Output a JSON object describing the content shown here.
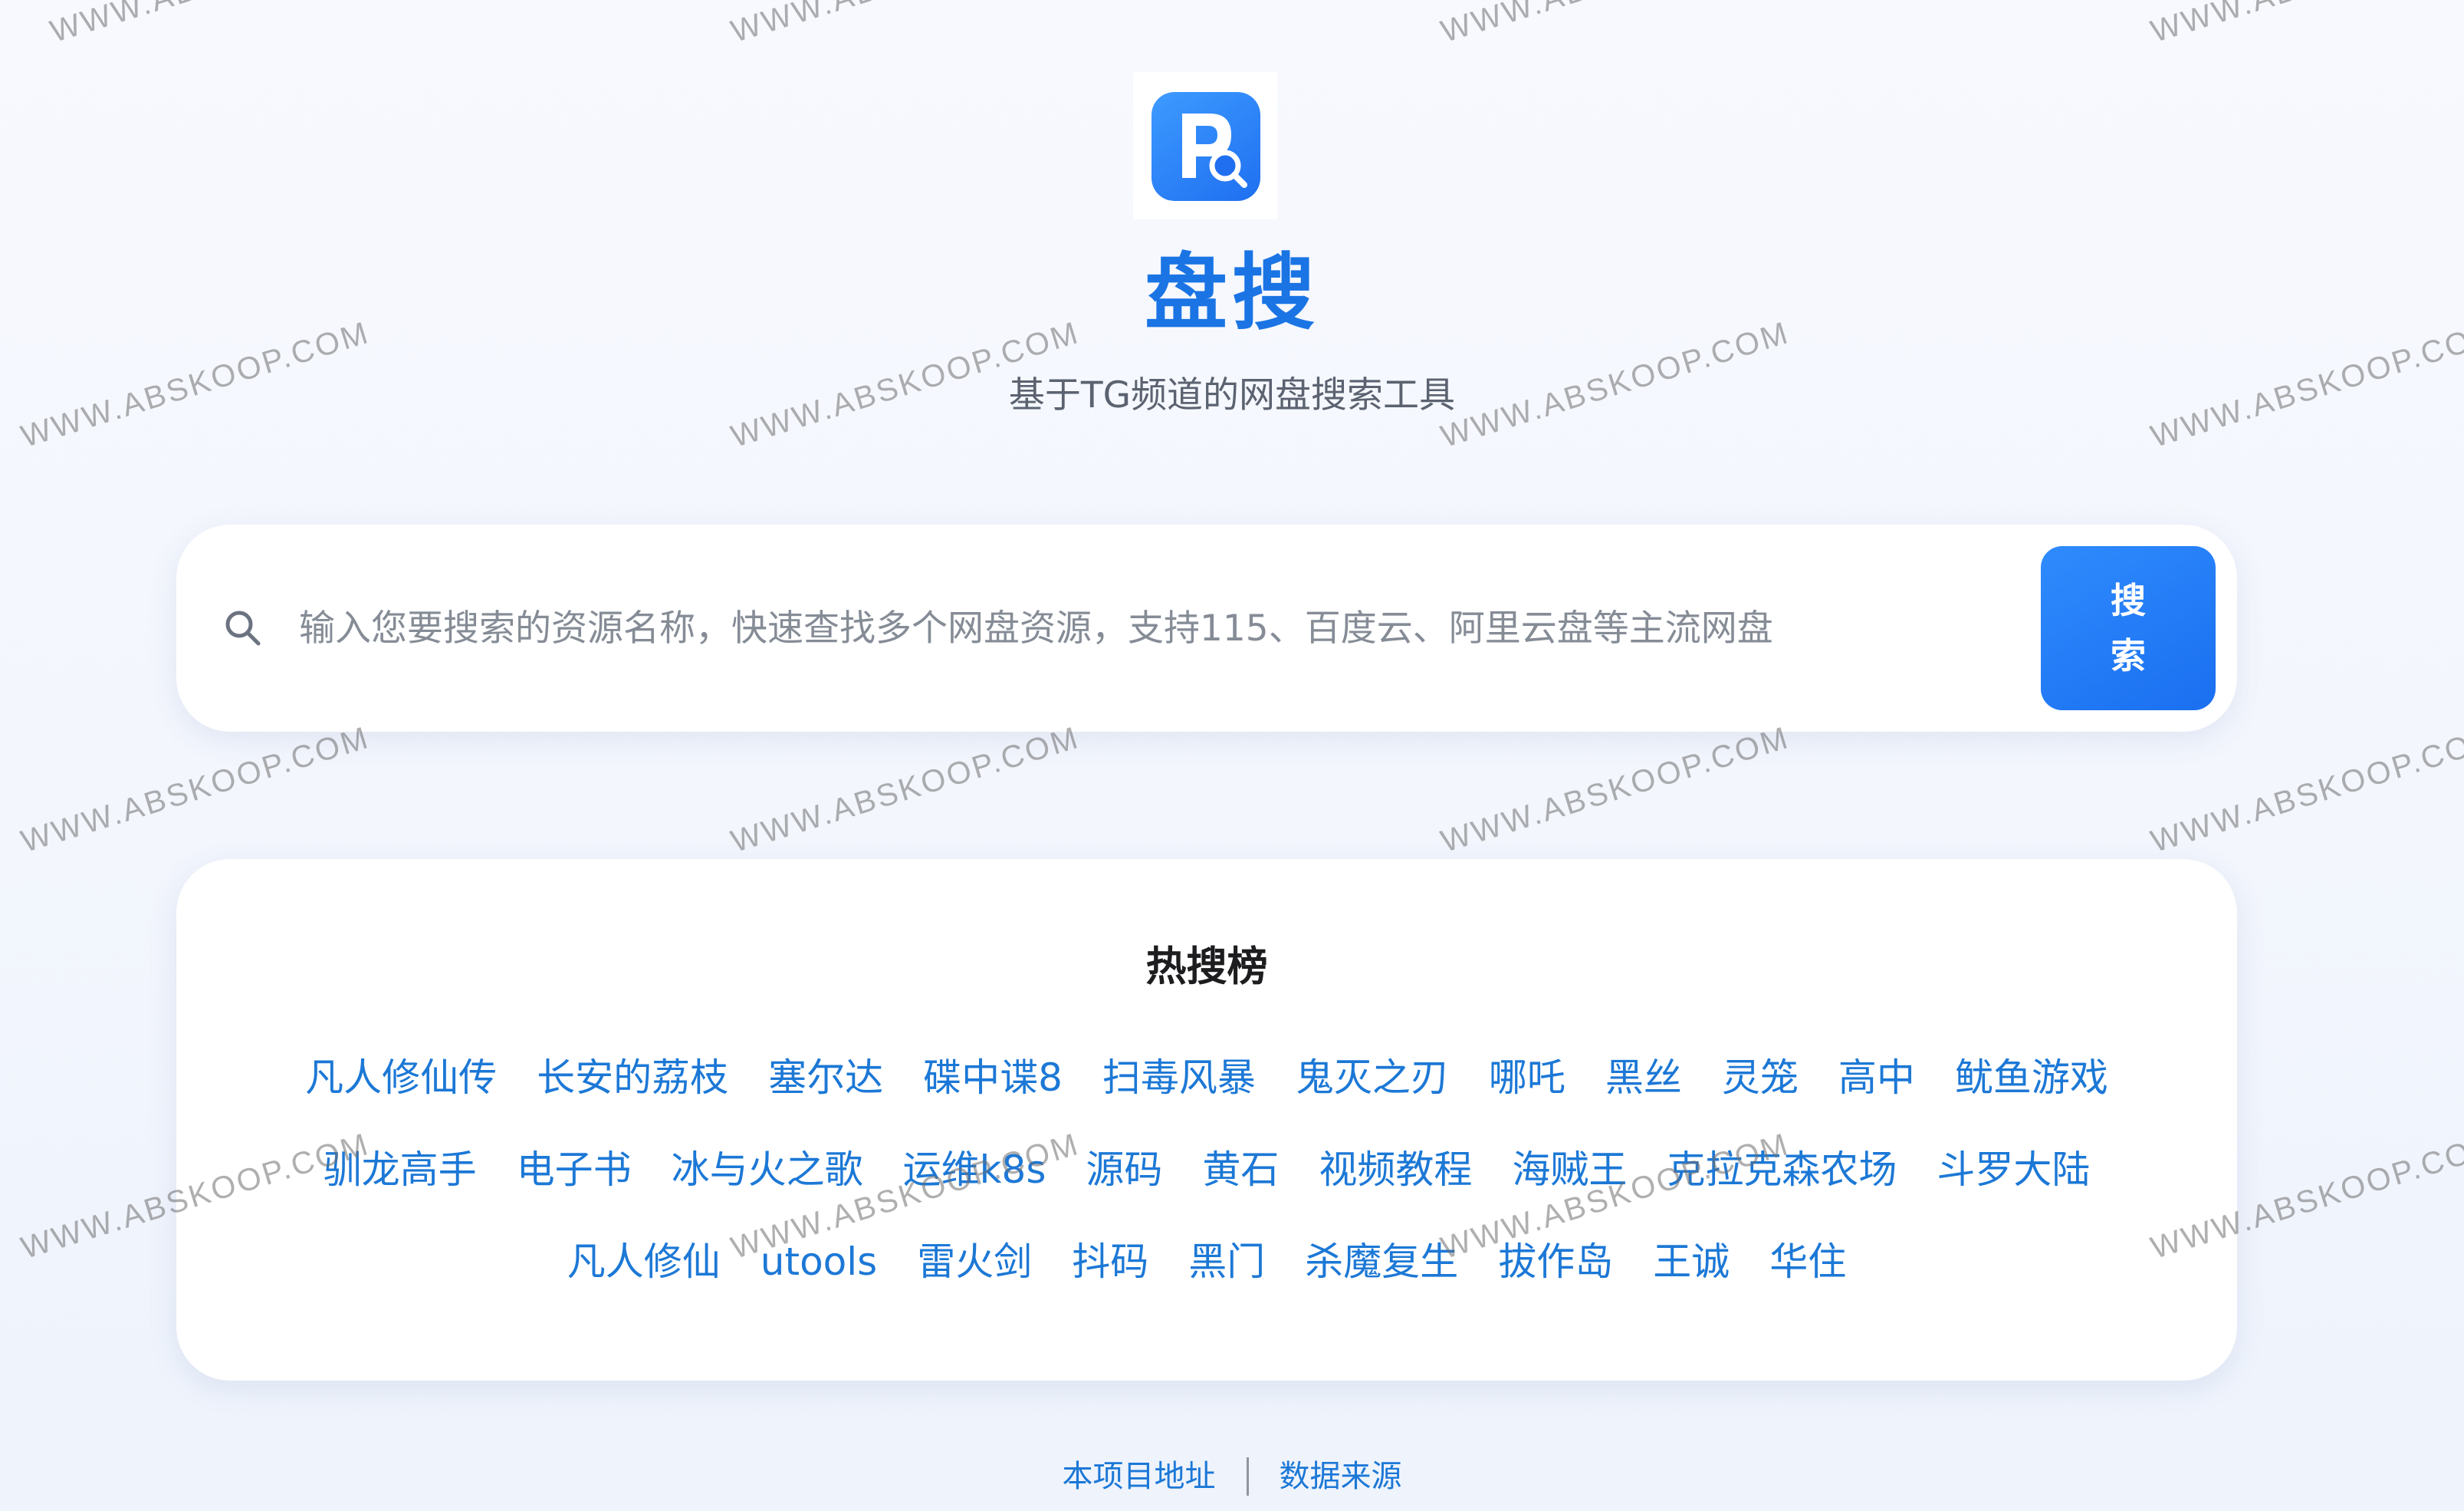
{
  "watermark": "WWW.ABSKOOP.COM",
  "header": {
    "logo_icon": "p-search-logo-icon",
    "title": "盘搜",
    "subtitle": "基于TG频道的网盘搜索工具"
  },
  "search": {
    "icon": "search-icon",
    "placeholder": "输入您要搜索的资源名称，快速查找多个网盘资源，支持115、百度云、阿里云盘等主流网盘",
    "value": "",
    "button_label": "搜索"
  },
  "hot": {
    "title": "热搜榜",
    "items": [
      "凡人修仙传",
      "长安的荔枝",
      "塞尔达",
      "碟中谍8",
      "扫毒风暴",
      "鬼灭之刃",
      "哪吒",
      "黑丝",
      "灵笼",
      "高中",
      "鱿鱼游戏",
      "驯龙高手",
      "电子书",
      "冰与火之歌",
      "运维k8s",
      "源码",
      "黄石",
      "视频教程",
      "海贼王",
      "克拉克森农场",
      "斗罗大陆",
      "凡人修仙",
      "utools",
      "雷火剑",
      "抖码",
      "黑门",
      "杀魔复生",
      "拔作岛",
      "王诚",
      "华住"
    ]
  },
  "footer": {
    "project_link": "本项目地址",
    "source_link": "数据来源"
  },
  "colors": {
    "accent": "#1a74e4",
    "link": "#1c78d6",
    "button": "#2f8bfd",
    "background": "#f4f7fd"
  }
}
